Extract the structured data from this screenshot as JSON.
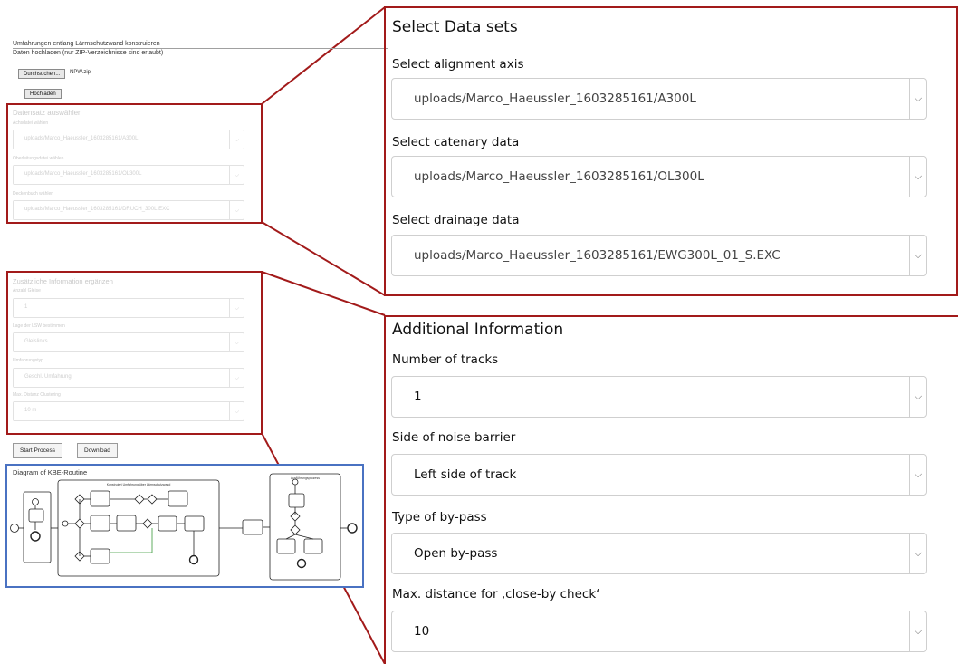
{
  "small_ui": {
    "heading": "Umfahrungen entlang Lärmschutzwand konstruieren",
    "upload_note": "Daten hochladen (nur ZIP-Verzeichnisse sind erlaubt)",
    "browse_button": "Durchsuchen...",
    "file_name": "NPW.zip",
    "upload_button": "Hochladen",
    "datasets": {
      "title": "Datensatz auswählen",
      "axis_label": "Achsdatei wählen",
      "axis_value": "uploads/Marco_Haeussler_1603285161/A300L",
      "catenary_label": "Oberleitungsdatei wählen",
      "catenary_value": "uploads/Marco_Haeussler_1603285161/OL300L",
      "drainage_label": "Deckenbuch wählen",
      "drainage_value": "uploads/Marco_Haeussler_1603285161/DRUCH_300L.EXC"
    },
    "additional": {
      "title": "Zusätzliche Information ergänzen",
      "tracks_label": "Anzahl Gleise",
      "tracks_value": "1",
      "side_label": "Lage der LSW bestimmen",
      "side_value": "Gleislinks",
      "bypass_label": "Umfahrungstyp",
      "bypass_value": "Geschl. Umfahrung",
      "distance_label": "Max. Distanz Clustering",
      "distance_value": "10 m"
    },
    "start_button": "Start Process",
    "download_button": "Download",
    "diagram_title": "Diagram of KBE-Routine",
    "diagram_lane_title": "Konstruiert Umfahrung über Lärmschutzwand",
    "diagram_lane2_title": "Ausführungsprozess"
  },
  "zoom_datasets": {
    "title": "Select Data sets",
    "axis_label": "Select alignment axis",
    "axis_value": "uploads/Marco_Haeussler_1603285161/A300L",
    "catenary_label": "Select catenary data",
    "catenary_value": "uploads/Marco_Haeussler_1603285161/OL300L",
    "drainage_label": "Select drainage data",
    "drainage_value": "uploads/Marco_Haeussler_1603285161/EWG300L_01_S.EXC"
  },
  "zoom_additional": {
    "title": "Additional Information",
    "tracks_label": "Number of tracks",
    "tracks_value": "1",
    "side_label": "Side of noise barrier",
    "side_value": "Left side of track",
    "bypass_label": "Type of by-pass",
    "bypass_value": "Open by-pass",
    "distance_label": "Max. distance for ‚close-by check‘",
    "distance_value": "10"
  },
  "icons": {
    "dropdown": "chevron-down-icon"
  },
  "colors": {
    "highlight_red": "#a21a1a",
    "diagram_blue": "#4a72c2"
  }
}
